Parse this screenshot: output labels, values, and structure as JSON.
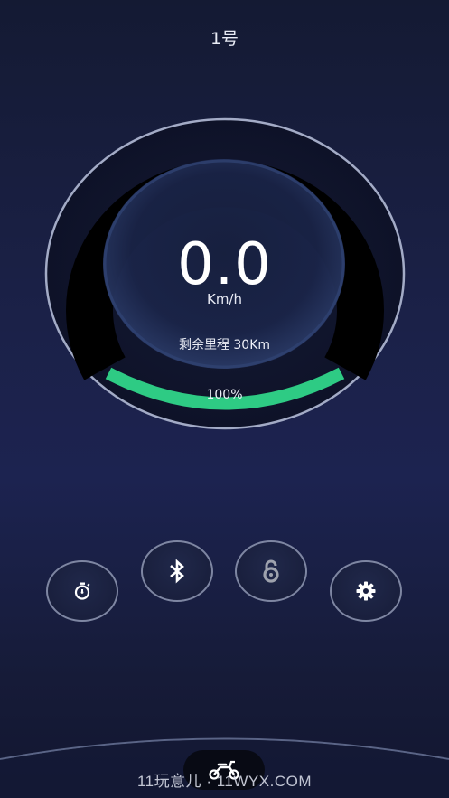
{
  "header": {
    "title": "1号"
  },
  "gauge": {
    "speed": "0.0",
    "unit": "Km/h",
    "range_text": "剩余里程 30Km",
    "battery_text": "100%",
    "battery_fraction": 1.0,
    "colors": {
      "battery_arc": "#2ecb84",
      "track": "#000000",
      "ring": "#9aa3bf"
    }
  },
  "controls": [
    {
      "name": "timer-button",
      "icon": "stopwatch-icon"
    },
    {
      "name": "bluetooth-button",
      "icon": "bluetooth-icon"
    },
    {
      "name": "lock-button",
      "icon": "unlock-icon"
    },
    {
      "name": "settings-button",
      "icon": "gear-icon"
    }
  ],
  "footer": {
    "icon": "scooter-icon",
    "watermark": "11玩意儿 · 11WYX.COM"
  }
}
